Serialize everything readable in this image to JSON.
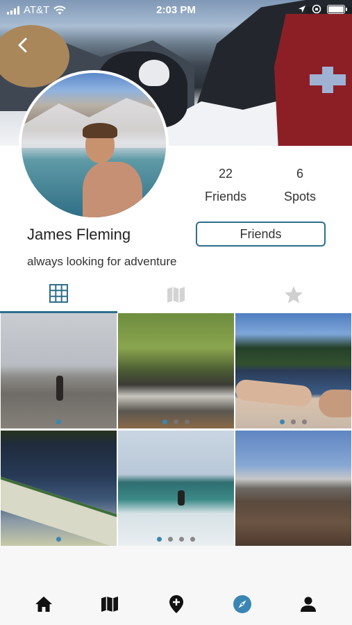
{
  "status_bar": {
    "carrier": "AT&T",
    "time": "2:03 PM"
  },
  "profile": {
    "name": "James Fleming",
    "bio": "always looking for adventure",
    "friends_count": "22",
    "friends_label": "Friends",
    "spots_count": "6",
    "spots_label": "Spots",
    "relationship_button": "Friends"
  },
  "tabs": [
    {
      "icon": "grid-icon",
      "active": true
    },
    {
      "icon": "map-icon",
      "active": false
    },
    {
      "icon": "star-icon",
      "active": false
    }
  ],
  "colors": {
    "accent": "#2f6e8b",
    "active_nav": "#3a86b3",
    "icon_dark": "#111111",
    "icon_inactive": "#d0d0d0"
  },
  "posts": [
    {
      "dots": 1,
      "active_dot": 0
    },
    {
      "dots": 3,
      "active_dot": 0
    },
    {
      "dots": 3,
      "active_dot": 0
    },
    {
      "dots": 1,
      "active_dot": 0
    },
    {
      "dots": 4,
      "active_dot": 0
    },
    {
      "dots": 0,
      "active_dot": 0
    }
  ],
  "bottom_nav": [
    {
      "icon": "home-icon"
    },
    {
      "icon": "map-icon"
    },
    {
      "icon": "add-location-icon"
    },
    {
      "icon": "compass-icon",
      "active": true
    },
    {
      "icon": "person-icon"
    }
  ]
}
